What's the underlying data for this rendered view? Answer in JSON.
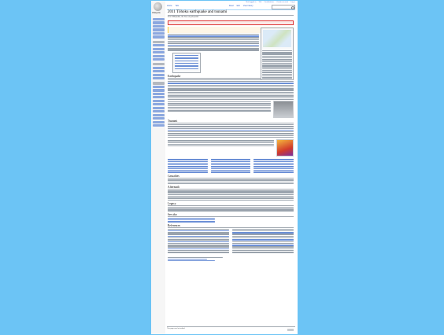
{
  "window": {
    "background": "#6cc4f5"
  },
  "wiki": {
    "site_name": "Wikipedia",
    "article_title": "2011 Tōhoku earthquake and tsunami",
    "subtitle": "From Wikipedia, the free encyclopedia",
    "tabs": [
      "Article",
      "Talk",
      "Read",
      "Edit",
      "View history"
    ],
    "search": {
      "placeholder": "Search Wikipedia"
    },
    "top_links": [
      "Not logged in",
      "Talk",
      "Contributions",
      "Create account",
      "Log in"
    ],
    "sections": [
      "Earthquake",
      "Tsunami",
      "Casualties",
      "Aftermath",
      "Legacy",
      "See also",
      "References"
    ],
    "footer_text": "This page was last edited"
  }
}
